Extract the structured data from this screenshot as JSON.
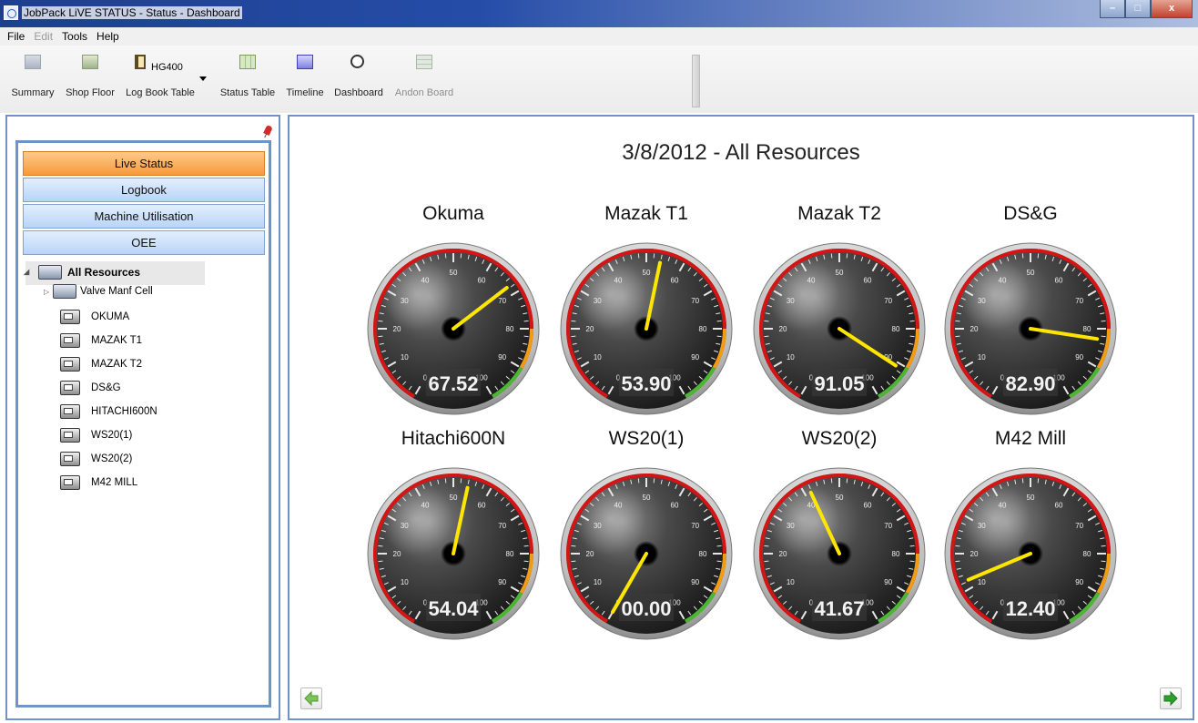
{
  "window": {
    "title": "JobPack LiVE STATUS - Status - Dashboard",
    "controls": {
      "minimize": "–",
      "maximize": "□",
      "close": "x"
    }
  },
  "menu": [
    "File",
    "Edit",
    "Tools",
    "Help"
  ],
  "toolbar": {
    "summary": "Summary",
    "shop_floor": "Shop Floor",
    "log_book_table": "Log Book Table",
    "log_book_selected": "HG400",
    "status_table": "Status Table",
    "timeline": "Timeline",
    "dashboard": "Dashboard",
    "andon_board": "Andon Board"
  },
  "nav": {
    "live_status": "Live Status",
    "logbook": "Logbook",
    "machine_utilisation": "Machine Utilisation",
    "oee": "OEE"
  },
  "tree": {
    "root": "All Resources",
    "group": "Valve Manf Cell",
    "machines": [
      "OKUMA",
      "MAZAK T1",
      "MAZAK T2",
      "DS&G",
      "HITACHI600N",
      "WS20(1)",
      "WS20(2)",
      "M42 MILL"
    ]
  },
  "dashboard": {
    "title": "3/8/2012 - All Resources",
    "scale_ticks": [
      "0",
      "10",
      "20",
      "30",
      "40",
      "50",
      "60",
      "70",
      "80",
      "90",
      "100"
    ],
    "gauges": [
      {
        "name": "Okuma",
        "readout": "67.52",
        "value": 67.52
      },
      {
        "name": "Mazak T1",
        "readout": "53.90",
        "value": 53.9
      },
      {
        "name": "Mazak T2",
        "readout": "91.05",
        "value": 91.05
      },
      {
        "name": "DS&G",
        "readout": "82.90",
        "value": 82.9
      },
      {
        "name": "Hitachi600N",
        "readout": "54.04",
        "value": 54.04
      },
      {
        "name": "WS20(1)",
        "readout": "00.00",
        "value": 0.0
      },
      {
        "name": "WS20(2)",
        "readout": "41.67",
        "value": 41.67
      },
      {
        "name": "M42 Mill",
        "readout": "12.40",
        "value": 12.4
      }
    ],
    "colors": {
      "needle": "#ffe600",
      "band_red": "#d41515",
      "band_orange": "#f49b14",
      "band_green": "#4cb832",
      "face": "#2b2b2b"
    }
  },
  "icons": {
    "prev": "left-arrow-icon",
    "next": "right-arrow-icon",
    "pin": "pin-icon"
  }
}
